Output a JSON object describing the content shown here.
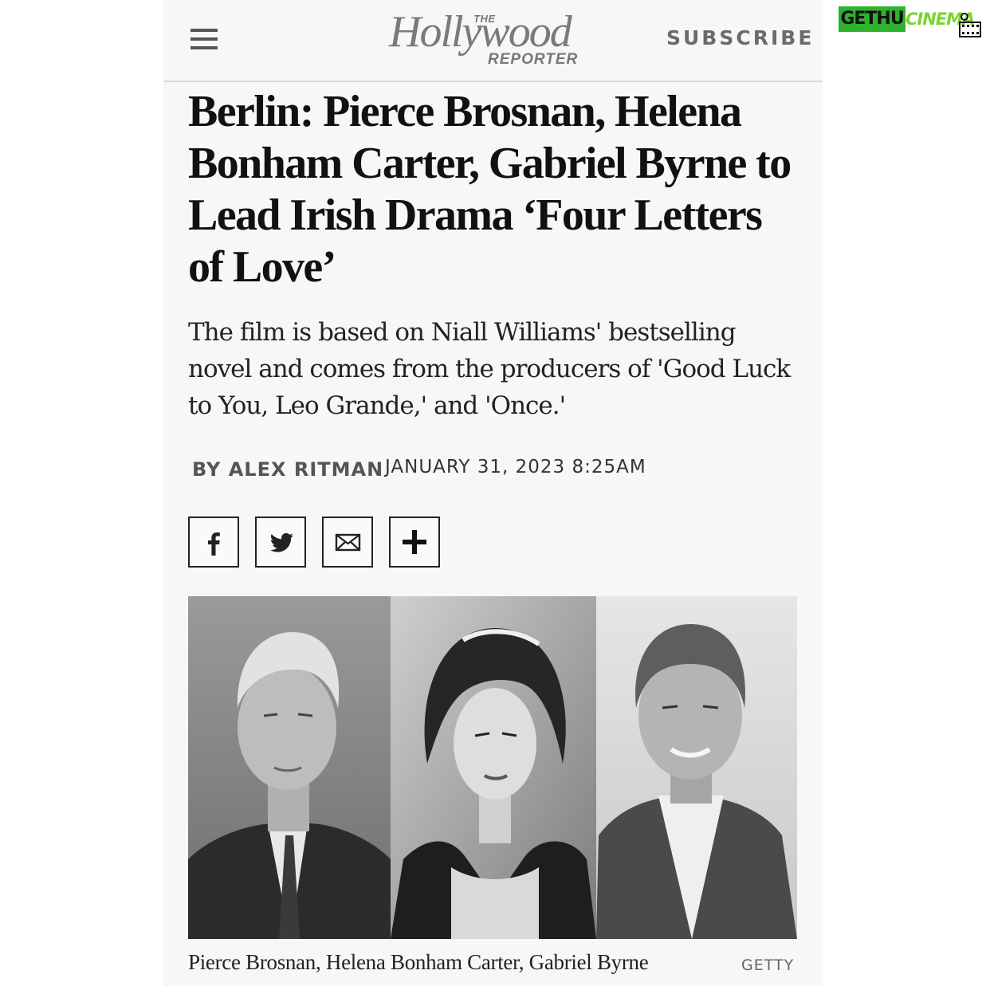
{
  "header": {
    "logo_the": "THE",
    "logo_main": "Hollywood",
    "logo_reporter": "REPORTER",
    "subscribe_label": "SUBSCRIBE",
    "menu_icon": "hamburger-menu-icon"
  },
  "article": {
    "headline": "Berlin: Pierce Brosnan, Helena Bonham Carter, Gabriel Byrne to Lead Irish Drama ‘Four Letters of Love’",
    "dek": "The film is based on Niall Williams' bestselling novel and comes from the producers of 'Good Luck to You, Leo Grande,' and 'Once.'",
    "byline": "BY ALEX RITMAN",
    "date": "JANUARY 31, 2023 8:25AM"
  },
  "share": [
    {
      "icon": "facebook-icon"
    },
    {
      "icon": "twitter-icon"
    },
    {
      "icon": "email-icon"
    },
    {
      "icon": "plus-icon"
    }
  ],
  "photo": {
    "caption": "Pierce Brosnan, Helena Bonham Carter, Gabriel Byrne",
    "credit": "GETTY"
  },
  "watermark": {
    "part1": "GETHU",
    "part2": "CINEMA"
  },
  "colors": {
    "card_background": "#f7f7f7",
    "text": "#111111",
    "watermark_green": "#2db32d"
  }
}
